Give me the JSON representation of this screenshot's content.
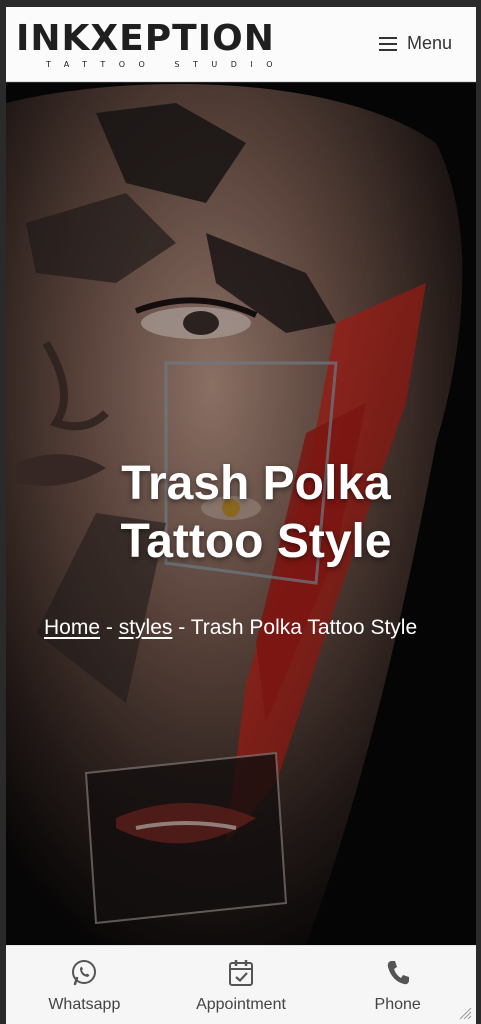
{
  "header": {
    "logo_main": "INKXEPTION",
    "logo_sub": "TATTOO STUDIO",
    "menu_label": "Menu"
  },
  "hero": {
    "title_line1": "Trash Polka",
    "title_line2": "Tattoo Style",
    "breadcrumb": {
      "home": "Home",
      "sep1": " - ",
      "styles": "styles",
      "sep2": " - ",
      "current": "Trash Polka Tattoo Style"
    }
  },
  "bottom_bar": {
    "items": [
      {
        "label": "Whatsapp",
        "icon": "whatsapp-icon"
      },
      {
        "label": "Appointment",
        "icon": "calendar-check-icon"
      },
      {
        "label": "Phone",
        "icon": "phone-icon"
      }
    ]
  },
  "colors": {
    "header_bg": "#fbfbfb",
    "hero_bg": "#080808",
    "accent_red": "#c8231e",
    "text_dark": "#1f1f1f",
    "bottom_bar_bg": "#f6f6f6"
  }
}
